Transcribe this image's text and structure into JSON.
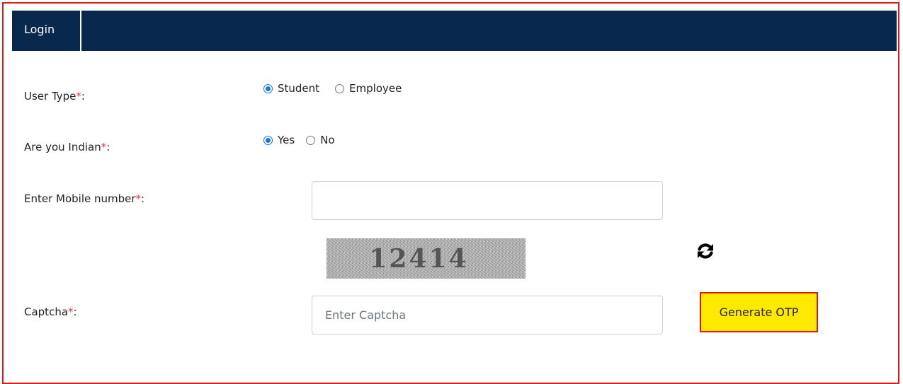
{
  "header": {
    "tab_label": "Login"
  },
  "form": {
    "user_type": {
      "label": "User Type",
      "required_mark": "*",
      "suffix": ":",
      "options": [
        {
          "label": "Student",
          "selected": true
        },
        {
          "label": "Employee",
          "selected": false
        }
      ]
    },
    "indian": {
      "label": "Are you Indian",
      "required_mark": "*",
      "suffix": ":",
      "options": [
        {
          "label": "Yes",
          "selected": true
        },
        {
          "label": "No",
          "selected": false
        }
      ]
    },
    "mobile": {
      "label": "Enter Mobile number",
      "required_mark": "*",
      "suffix": ":",
      "value": "",
      "placeholder": ""
    },
    "captcha_image": {
      "text": "12414"
    },
    "refresh_icon": "refresh-icon",
    "captcha": {
      "label": "Captcha",
      "required_mark": "*",
      "suffix": ":",
      "value": "",
      "placeholder": "Enter Captcha"
    },
    "generate_otp_label": "Generate OTP"
  },
  "colors": {
    "header_bg": "#08284e",
    "frame_border": "#e01919",
    "required": "#e8403a",
    "button_bg": "#ffe900",
    "radio_selected": "#1a73e8"
  }
}
